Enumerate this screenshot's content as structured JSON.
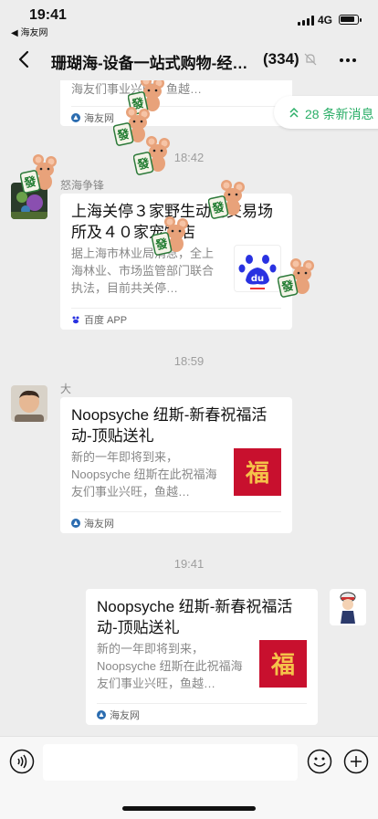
{
  "status_bar": {
    "time": "19:41",
    "back_app": "◀ 海友网",
    "network": "4G"
  },
  "nav": {
    "title": "珊瑚海-设备一站式购物-经…",
    "count": "(334)"
  },
  "new_messages": {
    "label": "28 条新消息"
  },
  "messages": [
    {
      "type": "card-partial",
      "desc": "海友们事业兴旺，鱼越…",
      "source": "海友网"
    },
    {
      "type": "timestamp",
      "text": "18:42"
    },
    {
      "type": "card",
      "sender": "怒海争锋",
      "title": "上海关停３家野生动物交易场所及４０家宠物店",
      "desc": "据上海市林业局消息，全上海林业、市场监管部门联合执法，目前共关停…",
      "source": "百度 APP",
      "thumb_text": "du"
    },
    {
      "type": "timestamp",
      "text": "18:59"
    },
    {
      "type": "card",
      "sender": "大",
      "title": "Noopsyche 纽斯-新春祝福活动-顶贴送礼",
      "desc": "新的一年即将到来，Noopsyche 纽斯在此祝福海友们事业兴旺，鱼越…",
      "source": "海友网",
      "thumb_text": "福"
    },
    {
      "type": "timestamp",
      "text": "19:41"
    },
    {
      "type": "card-self",
      "title": "Noopsyche 纽斯-新春祝福活动-顶贴送礼",
      "desc": "新的一年即将到来，Noopsyche 纽斯在此祝福海友们事业兴旺，鱼越…",
      "source": "海友网",
      "thumb_text": "福"
    }
  ],
  "stickers": {
    "char": "發"
  },
  "input": {
    "placeholder": ""
  },
  "colors": {
    "bg": "#ededed",
    "accent_green": "#2aae67",
    "card_bg": "#ffffff",
    "fu_red": "#c8102e"
  }
}
